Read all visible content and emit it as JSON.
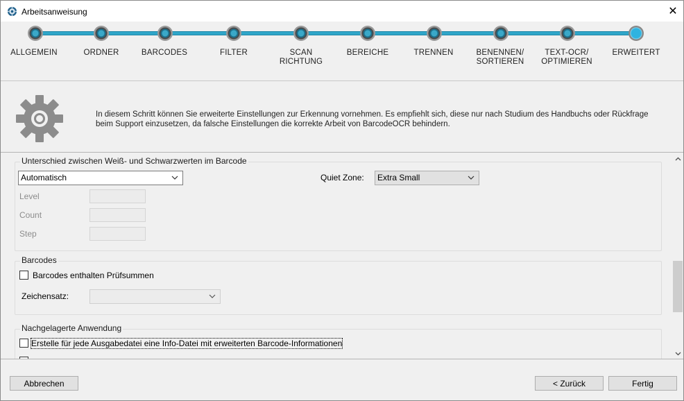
{
  "window": {
    "title": "Arbeitsanweisung",
    "icon": "gear-app-icon",
    "close_glyph": "✕"
  },
  "steps": [
    {
      "label": "ALLGEMEIN"
    },
    {
      "label": "ORDNER"
    },
    {
      "label": "BARCODES"
    },
    {
      "label": "FILTER"
    },
    {
      "label": "SCAN\nRICHTUNG"
    },
    {
      "label": "BEREICHE"
    },
    {
      "label": "TRENNEN"
    },
    {
      "label": "BENENNEN/\nSORTIEREN"
    },
    {
      "label": "TEXT-OCR/\nOPTIMIEREN"
    },
    {
      "label": "ERWEITERT"
    }
  ],
  "current_step": "ERWEITERT",
  "info": {
    "text": "In diesem Schritt können Sie erweiterte Einstellungen zur Erkennung vornehmen. Es empfiehlt sich, diese nur nach Studium des Handbuchs oder Rückfrage beim Support einzusetzen, da falsche Einstellungen die korrekte Arbeit von BarcodeOCR behindern."
  },
  "group_threshold": {
    "legend": "Unterschied zwischen Weiß- und Schwarzwerten im Barcode",
    "mode_value": "Automatisch",
    "level_label": "Level",
    "count_label": "Count",
    "step_label": "Step",
    "quiet_zone_label": "Quiet Zone:",
    "quiet_zone_value": "Extra Small"
  },
  "group_barcodes": {
    "legend": "Barcodes",
    "checksum_label": "Barcodes enthalten Prüfsummen",
    "checksum_checked": false,
    "charset_label": "Zeichensatz:",
    "charset_value": ""
  },
  "group_post": {
    "legend": "Nachgelagerte Anwendung",
    "infofile_label": "Erstelle für jede Ausgabedatei eine Info-Datei mit erweiterten Barcode-Informationen",
    "infofile_checked": false
  },
  "footer": {
    "cancel_label": "Abbrechen",
    "back_label": "< Zurück",
    "finish_label": "Fertig"
  },
  "colors": {
    "accent": "#2fa6c9",
    "gear": "#8c8c8c"
  }
}
